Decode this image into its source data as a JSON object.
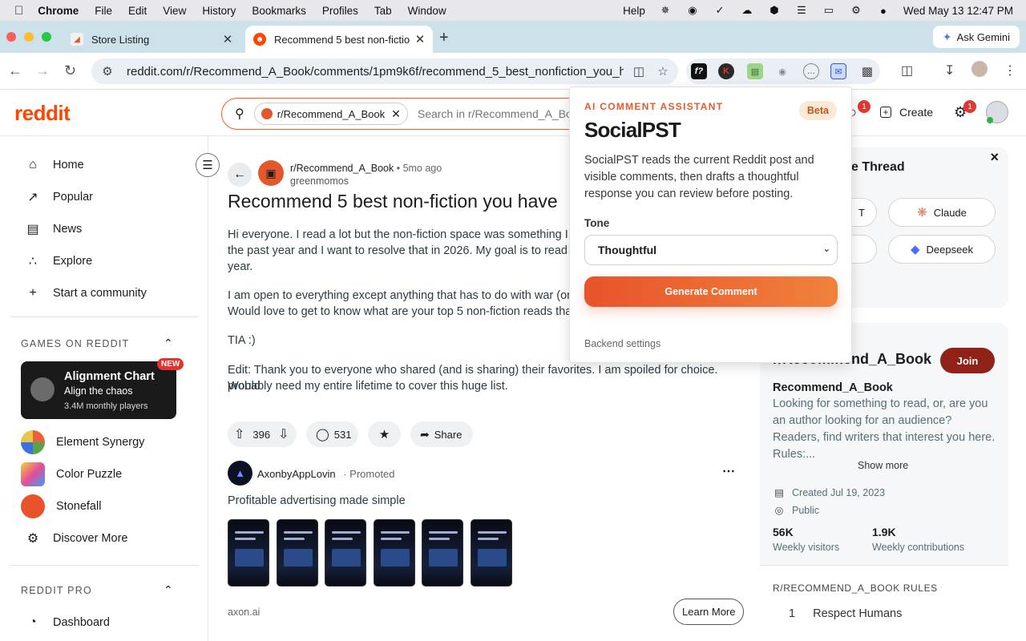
{
  "menubar": {
    "app": "Chrome",
    "items": [
      "File",
      "Edit",
      "View",
      "History",
      "Bookmarks",
      "Profiles",
      "Tab",
      "Window"
    ],
    "help": "Help",
    "clock": "Wed May 13  12:47 PM"
  },
  "tabs": [
    {
      "title": "Store Listing",
      "active": false
    },
    {
      "title": "Recommend 5 best non-fictio",
      "active": true
    }
  ],
  "gemini_label": "Ask Gemini",
  "url": "reddit.com/r/Recommend_A_Book/comments/1pm9k6f/recommend_5_best_nonfiction_you_h...",
  "reddit": {
    "logo": "reddit",
    "search_chip": "r/Recommend_A_Book",
    "search_placeholder": "Search in r/Recommend_A_Book",
    "chat_badge": "1",
    "create": "Create",
    "notif_badge": "1"
  },
  "sidebar": {
    "nav": [
      {
        "label": "Home",
        "icon": "home-icon"
      },
      {
        "label": "Popular",
        "icon": "popular-icon"
      },
      {
        "label": "News",
        "icon": "news-icon"
      },
      {
        "label": "Explore",
        "icon": "explore-icon"
      },
      {
        "label": "Start a community",
        "icon": "plus-icon"
      }
    ],
    "games_header": "GAMES ON REDDIT",
    "featured_game": {
      "title": "Alignment Chart",
      "subtitle": "Align the chaos",
      "players": "3.4M monthly players",
      "badge": "NEW"
    },
    "games": [
      {
        "label": "Element Synergy"
      },
      {
        "label": "Color Puzzle"
      },
      {
        "label": "Stonefall"
      },
      {
        "label": "Discover More"
      }
    ],
    "pro_header": "REDDIT PRO",
    "pro_items": [
      {
        "label": "Dashboard"
      }
    ]
  },
  "post": {
    "subreddit": "r/Recommend_A_Book",
    "age": "• 5mo ago",
    "author": "greenmomos",
    "title": "Recommend 5 best non-fiction you have",
    "paragraphs": [
      "Hi everyone. I read a lot but the non-fiction space was something I h",
      "the past year and I want to resolve that in 2026. My goal is to read a",
      "year.",
      "I am open to everything except anything that has to do with war (or r",
      "Would love to get to know what are your top 5 non-fiction reads that",
      "TIA :)",
      "Edit: Thank you to everyone who shared (and is sharing) their favorites. I am spoiled for choice. Would",
      "probably need my entire lifetime to cover this huge list."
    ],
    "votes": "396",
    "comments": "531",
    "share": "Share"
  },
  "promo": {
    "name": "AxonbyAppLovin",
    "tag": "Promoted",
    "line": "Profitable advertising made simple",
    "thumb_count": 6,
    "domain": "axon.ai",
    "cta": "Learn More"
  },
  "thread_box": {
    "title_fragment": "e Thread",
    "buttons": [
      {
        "label": "T",
        "icon": ""
      },
      {
        "label": "Claude",
        "icon": "claude-icon"
      },
      {
        "label": "",
        "icon": ""
      },
      {
        "label": "Deepseek",
        "icon": "deepseek-icon"
      }
    ]
  },
  "about": {
    "title": "r/Recommend_A_Book",
    "join": "Join",
    "name": "Recommend_A_Book",
    "desc": "Looking for something to read, or, are you an author looking for an audience? Readers, find writers that interest you here. Rules:...",
    "show_more": "Show more",
    "created": "Created Jul 19, 2023",
    "visibility": "Public",
    "visitors": "56K",
    "visitors_label": "Weekly visitors",
    "contributions": "1.9K",
    "contributions_label": "Weekly contributions",
    "rules_header": "R/RECOMMEND_A_BOOK RULES",
    "rule1_num": "1",
    "rule1": "Respect Humans"
  },
  "popup": {
    "kicker": "AI COMMENT ASSISTANT",
    "beta": "Beta",
    "title": "SocialPST",
    "description": "SocialPST reads the current Reddit post and visible comments, then drafts a thoughtful response you can review before posting.",
    "tone_label": "Tone",
    "tone_value": "Thoughtful",
    "generate": "Generate Comment",
    "backend": "Backend settings"
  },
  "colors": {
    "reddit_orange": "#ff4500",
    "join": "#8f2117",
    "accent": "#e9532a"
  }
}
